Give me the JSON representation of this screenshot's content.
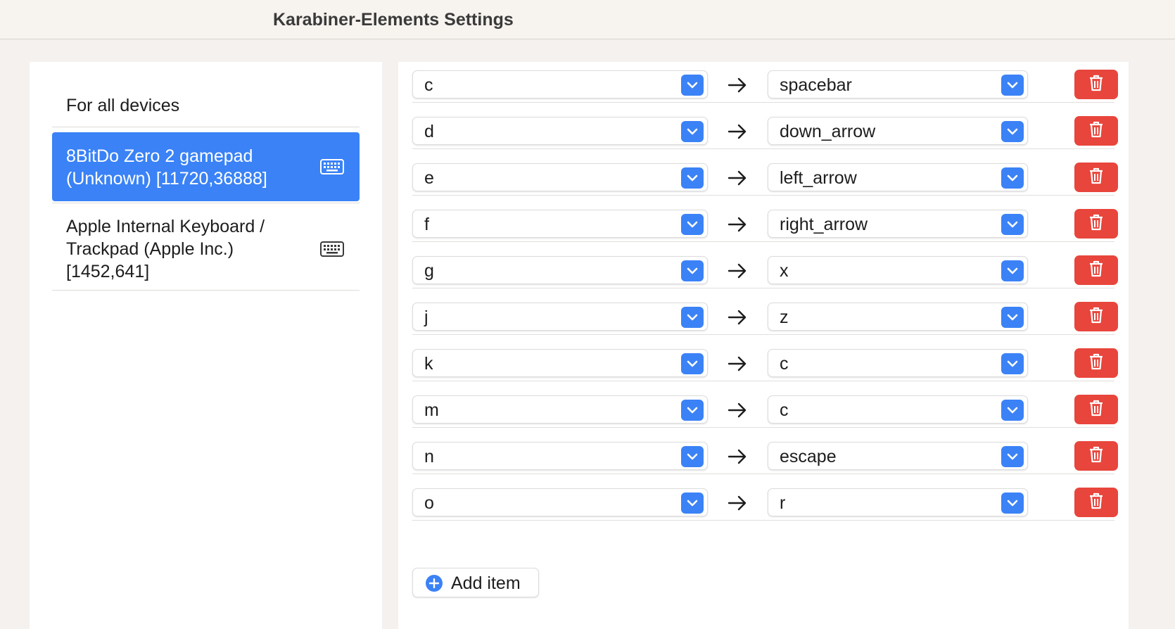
{
  "window": {
    "title": "Karabiner-Elements Settings"
  },
  "sidebar": {
    "all_devices_label": "For all devices",
    "devices": [
      {
        "name": "8BitDo Zero 2 gamepad\n(Unknown) [11720,36888]",
        "icon": "keyboard-icon",
        "selected": true
      },
      {
        "name": "Apple Internal Keyboard /\nTrackpad (Apple Inc.)\n[1452,641]",
        "icon": "keyboard-icon",
        "selected": false
      }
    ]
  },
  "mappings": [
    {
      "from": "c",
      "to": "spacebar"
    },
    {
      "from": "d",
      "to": "down_arrow"
    },
    {
      "from": "e",
      "to": "left_arrow"
    },
    {
      "from": "f",
      "to": "right_arrow"
    },
    {
      "from": "g",
      "to": "x"
    },
    {
      "from": "j",
      "to": "z"
    },
    {
      "from": "k",
      "to": "c"
    },
    {
      "from": "m",
      "to": "c"
    },
    {
      "from": "n",
      "to": "escape"
    },
    {
      "from": "o",
      "to": "r"
    }
  ],
  "add_item_label": "Add item",
  "colors": {
    "accent": "#3b82f6",
    "selected_row": "#3a82f6",
    "delete": "#e8453c",
    "background": "#f4f1ee"
  }
}
